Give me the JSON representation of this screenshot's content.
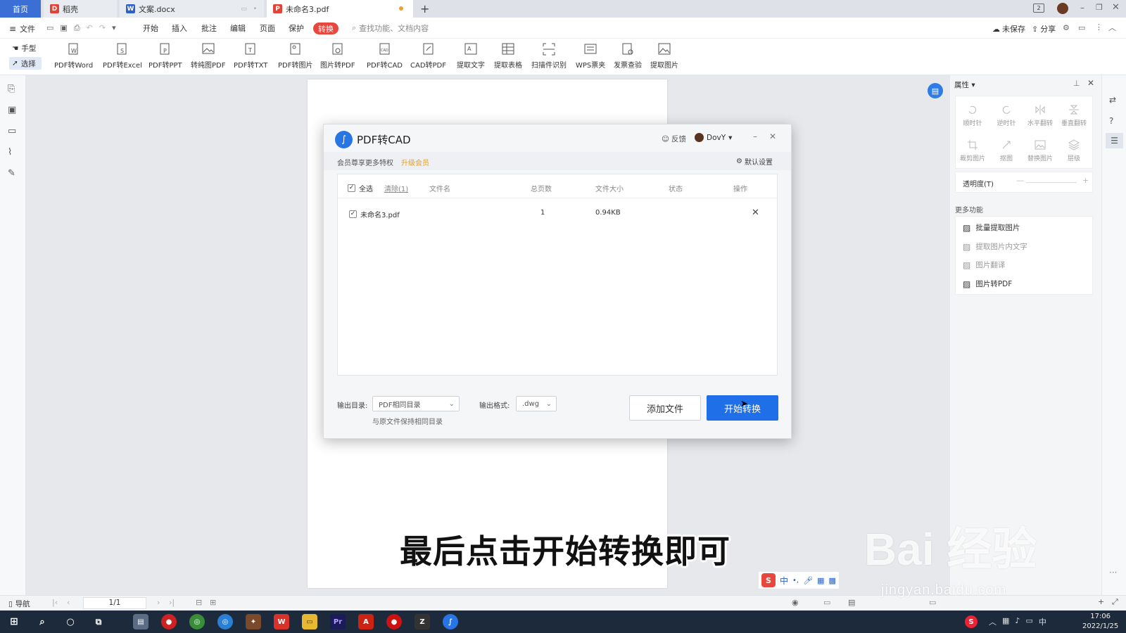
{
  "tabs": {
    "home": "首页",
    "docer": "稻壳",
    "docx": "文案.docx",
    "pdf": "未命名3.pdf",
    "new_tab": "+"
  },
  "menu": {
    "file": "文件",
    "items": [
      "开始",
      "插入",
      "批注",
      "编辑",
      "页面",
      "保护",
      "转换"
    ],
    "search_placeholder": "查找功能、文档内容",
    "unsaved": "未保存",
    "share": "分享"
  },
  "toolbar": {
    "hand": "手型",
    "select": "选择",
    "buttons": [
      "PDF转Word",
      "PDF转Excel",
      "PDF转PPT",
      "转纯图PDF",
      "PDF转TXT",
      "PDF转图片",
      "图片转PDF",
      "PDF转CAD",
      "CAD转PDF",
      "提取文字",
      "提取表格",
      "扫描件识别",
      "WPS票夹",
      "发票查验",
      "提取图片"
    ]
  },
  "right_panel": {
    "title": "属性",
    "row1": [
      "顺时针",
      "逆时针",
      "水平翻转",
      "垂直翻转"
    ],
    "row2": [
      "裁剪图片",
      "抠图",
      "替换图片",
      "层级"
    ],
    "opacity_label": "透明度(T)",
    "more_title": "更多功能",
    "more_items": [
      "批量提取图片",
      "提取图片内文字",
      "图片翻译",
      "图片转PDF"
    ]
  },
  "dialog": {
    "title": "PDF转CAD",
    "feedback": "反馈",
    "user": "DovY",
    "member_text": "会员尊享更多特权",
    "upgrade": "升级会员",
    "default_settings": "默认设置",
    "columns": {
      "select_all": "全选",
      "clear": "清除(1)",
      "filename": "文件名",
      "pages": "总页数",
      "size": "文件大小",
      "status": "状态",
      "action": "操作"
    },
    "files": [
      {
        "name": "未命名3.pdf",
        "pages": "1",
        "size": "0.94KB",
        "status": ""
      }
    ],
    "output_dir_label": "输出目录:",
    "output_dir_value": "PDF相同目录",
    "output_dir_hint": "与原文件保持相同目录",
    "output_format_label": "输出格式:",
    "output_format_value": ".dwg",
    "add_file": "添加文件",
    "start": "开始转换"
  },
  "status_bar": {
    "nav": "导航",
    "page_indicator": "1/1"
  },
  "taskbar": {
    "time": "17:06",
    "date": "2022/1/25",
    "ime": "中"
  },
  "subtitle": "最后点击开始转换即可",
  "watermark": {
    "brand": "Bai 经验",
    "url": "jingyan.baidu.com"
  },
  "colors": {
    "accent": "#1e6fe8",
    "convert_pill": "#e8473d",
    "upgrade": "#e0a030"
  }
}
